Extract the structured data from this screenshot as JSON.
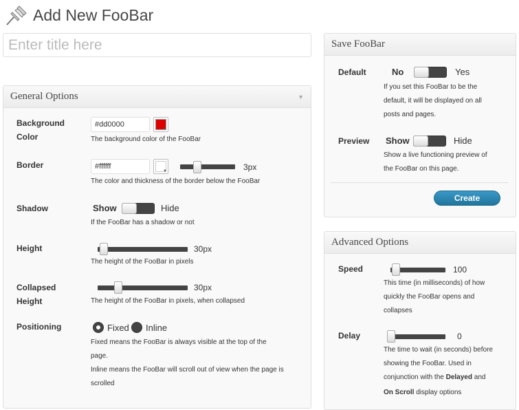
{
  "page": {
    "title": "Add New FooBar",
    "title_placeholder": "Enter title here"
  },
  "general": {
    "heading": "General Options",
    "background": {
      "label_line1": "Background",
      "label_line2": "Color",
      "value": "#dd0000",
      "desc": "The background color of the FooBar",
      "swatch": "#dd0000"
    },
    "border": {
      "label": "Border",
      "value": "#ffffff",
      "swatch": "#ffffff",
      "thickness": "3px",
      "thickness_fraction": 0.3,
      "desc": "The color and thickness of the border below the FooBar"
    },
    "shadow": {
      "label": "Shadow",
      "on": "Show",
      "off": "Hide",
      "desc": "If the FooBar has a shadow or not"
    },
    "height": {
      "label": "Height",
      "value": "30px",
      "fraction": 0.05,
      "desc": "The height of the FooBar in pixels"
    },
    "collapsed": {
      "label_line1": "Collapsed",
      "label_line2": "Height",
      "value": "30px",
      "fraction": 0.2,
      "desc": "The height of the FooBar in pixels, when collapsed"
    },
    "positioning": {
      "label": "Positioning",
      "option_fixed": "Fixed",
      "option_inline": "Inline",
      "selected": "Fixed",
      "desc_line1": "Fixed means the FooBar is always visible at the top of the",
      "desc_line2": "page.",
      "desc_line3": "Inline means the FooBar will scroll out of view when the page is",
      "desc_line4": "scrolled"
    }
  },
  "save": {
    "heading": "Save FooBar",
    "default": {
      "label": "Default",
      "on": "No",
      "off": "Yes",
      "desc_line1": "If you set this FooBar to be the",
      "desc_line2": "default, it will be displayed on all",
      "desc_line3": "posts and pages."
    },
    "preview": {
      "label": "Preview",
      "on": "Show",
      "off": "Hide",
      "desc_line1": "Show a live functioning preview of",
      "desc_line2": "the FooBar on this page."
    },
    "create_label": "Create"
  },
  "advanced": {
    "heading": "Advanced Options",
    "speed": {
      "label": "Speed",
      "value": "100",
      "fraction": 0.02,
      "desc_line1": "This time (in milliseconds) of how",
      "desc_line2": "quickly the FooBar opens and",
      "desc_line3": "collapses"
    },
    "delay": {
      "label": "Delay",
      "value": "0",
      "fraction": 0.0,
      "desc_line1": "The time to wait (in seconds) before",
      "desc_line2": "showing the FooBar. Used in",
      "desc_line3_pre": "conjunction with the ",
      "desc_line3_bold": "Delayed",
      "desc_line3_post": " and",
      "desc_line4_bold": "On Scroll",
      "desc_line4_post": " display options"
    }
  },
  "colors": {
    "accent": "#21759b",
    "track": "#444444"
  },
  "icons": {
    "header": "pushpin-icon"
  }
}
